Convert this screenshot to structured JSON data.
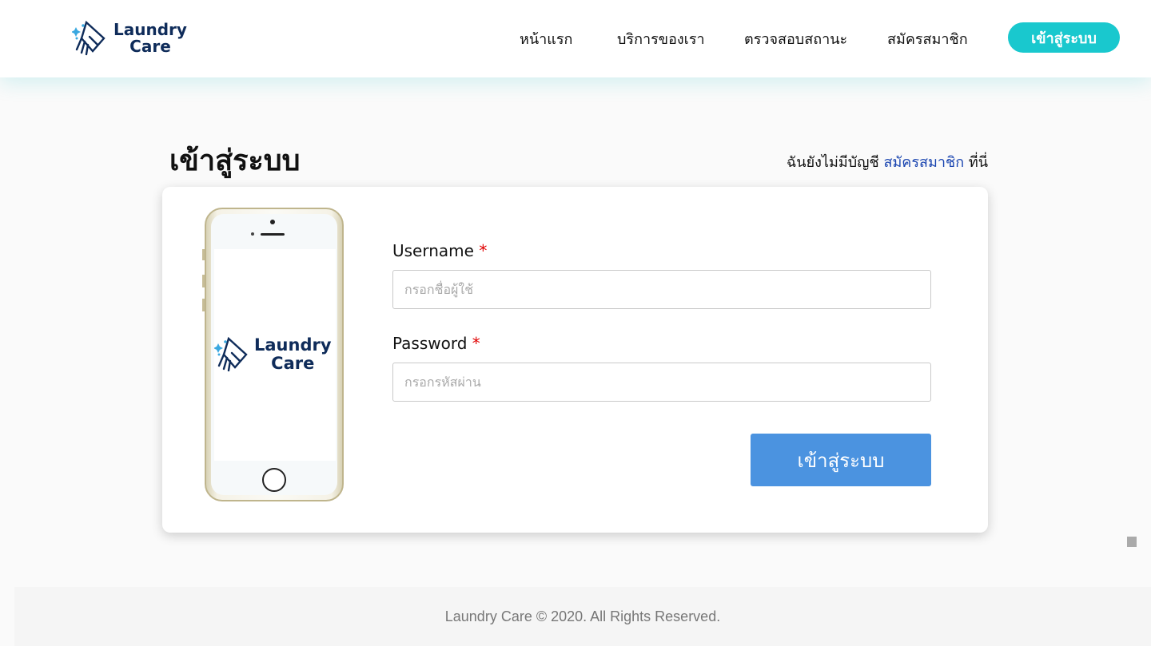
{
  "brand": {
    "line1": "Laundry",
    "line2": "Care",
    "primary_color": "#0f2c5a",
    "accent_color": "#19c8ce"
  },
  "nav": {
    "links": [
      "หน้าแรก",
      "บริการของเรา",
      "ตรวจสอบสถานะ",
      "สมัครสมาชิก"
    ],
    "login_button": "เข้าสู่ระบบ"
  },
  "page": {
    "title": "เข้าสู่ระบบ",
    "register_prefix": "ฉันยังไม่มีบัญชี",
    "register_link": "สมัครสมาชิก",
    "register_suffix": "ที่นี่"
  },
  "form": {
    "username": {
      "label": "Username",
      "required_mark": "*",
      "placeholder": "กรอกชื่อผู้ใช้",
      "value": ""
    },
    "password": {
      "label": "Password",
      "required_mark": "*",
      "placeholder": "กรอกรหัสผ่าน",
      "value": ""
    },
    "submit_label": "เข้าสู่ระบบ",
    "submit_color": "#4b93e0"
  },
  "phone_logo": {
    "line1": "Laundry",
    "line2": "Care"
  },
  "footer": {
    "text": "Laundry Care © 2020. All Rights Reserved."
  }
}
